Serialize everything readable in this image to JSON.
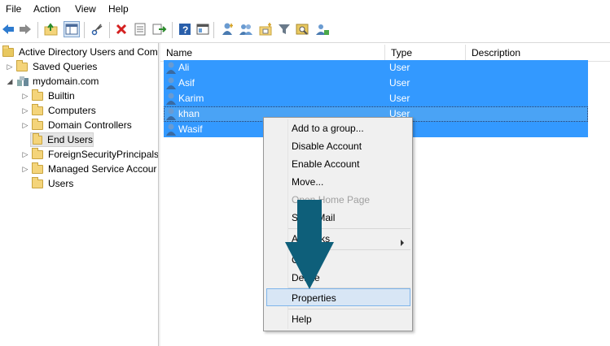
{
  "menu": [
    "File",
    "Action",
    "View",
    "Help"
  ],
  "toolbar": {
    "buttons": [
      "back-icon",
      "forward-icon",
      "up-folder-icon",
      "show-console-tree-icon",
      "cut-icon",
      "delete-icon",
      "properties-icon",
      "export-list-icon",
      "help-icon",
      "console-icon",
      "new-user-icon",
      "new-group-icon",
      "new-ou-icon",
      "filter-icon",
      "find-icon",
      "add-to-group-icon"
    ]
  },
  "tree": {
    "root": "Active Directory Users and Com",
    "saved_queries": "Saved Queries",
    "domain": "mydomain.com",
    "children": [
      "Builtin",
      "Computers",
      "Domain Controllers",
      "End Users",
      "ForeignSecurityPrincipals",
      "Managed Service Accour",
      "Users"
    ],
    "selected": "End Users"
  },
  "list": {
    "columns": [
      "Name",
      "Type",
      "Description"
    ],
    "rows": [
      {
        "name": "Ali",
        "type": "User"
      },
      {
        "name": "Asif",
        "type": "User"
      },
      {
        "name": "Karim",
        "type": "User"
      },
      {
        "name": "khan",
        "type": "User"
      },
      {
        "name": "Wasif",
        "type": ""
      }
    ]
  },
  "context_menu": {
    "items": [
      {
        "label": "Add to a group...",
        "disabled": false
      },
      {
        "label": "Disable Account",
        "disabled": false
      },
      {
        "label": "Enable Account",
        "disabled": false
      },
      {
        "label": "Move...",
        "disabled": false
      },
      {
        "label": "Open Home Page",
        "disabled": true
      },
      {
        "label": "Send Mail",
        "disabled": false
      },
      {
        "label": "All Tasks",
        "disabled": false
      },
      {
        "label": "Cut",
        "disabled": false
      },
      {
        "label": "Delete",
        "disabled": false
      },
      {
        "label": "Properties",
        "disabled": false
      },
      {
        "label": "Help",
        "disabled": false
      }
    ],
    "highlighted": "Properties"
  },
  "colors": {
    "selection": "#3399ff",
    "menu_highlight": "#d8e6f5",
    "annotation_arrow": "#0e5f7a"
  }
}
